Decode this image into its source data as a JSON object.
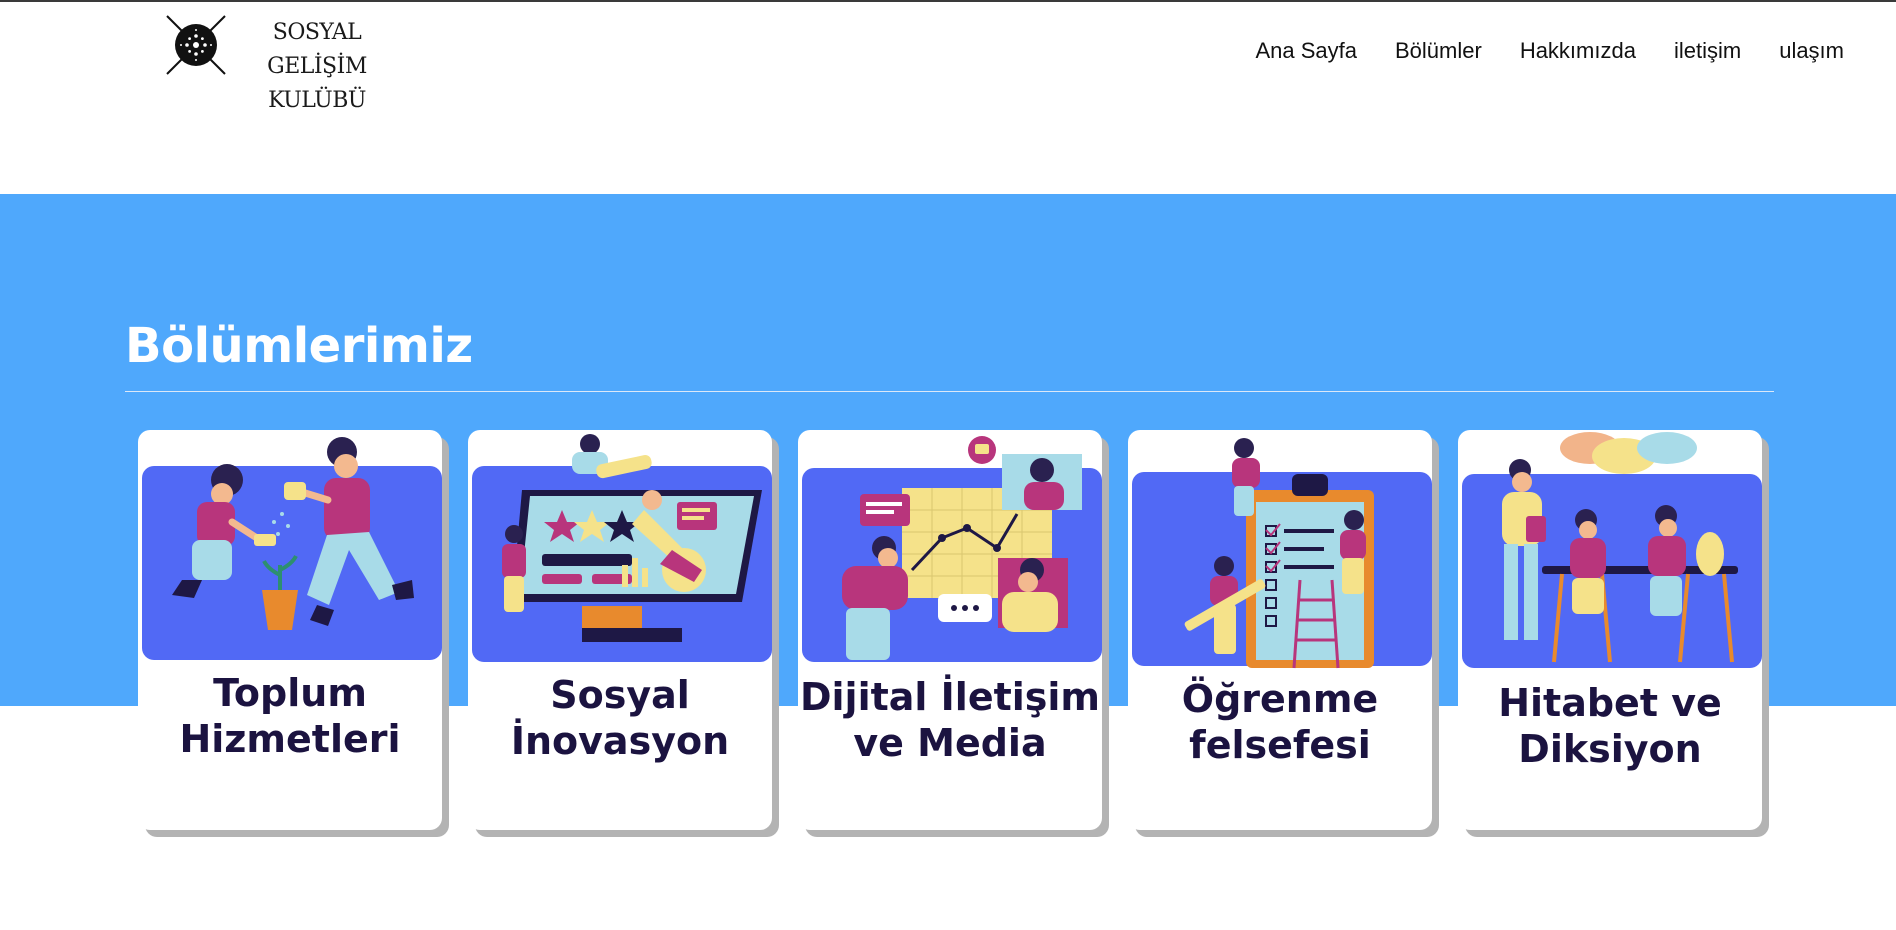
{
  "header": {
    "logo_line1": "SOSYAL GELİŞİM",
    "logo_line2": "KULÜBÜ",
    "logo_icon": "club-emblem-icon",
    "nav": [
      {
        "label": "Ana Sayfa"
      },
      {
        "label": "Bölümler"
      },
      {
        "label": "Hakkımızda"
      },
      {
        "label": "iletişim"
      },
      {
        "label": "ulaşım"
      }
    ]
  },
  "section": {
    "title": "Bölümlerimiz",
    "band_color": "#4fa8fc"
  },
  "cards": [
    {
      "line1": "Toplum",
      "line2": "Hizmetleri",
      "illustration": "community-service-illustration"
    },
    {
      "line1": "Sosyal",
      "line2": "İnovasyon",
      "illustration": "social-innovation-illustration"
    },
    {
      "line1": "Dijital İletişim",
      "line2": "ve Media",
      "illustration": "digital-communication-illustration"
    },
    {
      "line1": "Öğrenme",
      "line2": "felsefesi",
      "illustration": "learning-philosophy-illustration"
    },
    {
      "line1": "Hitabet ve",
      "line2": "Diksiyon",
      "illustration": "rhetoric-diction-illustration"
    }
  ],
  "colors": {
    "card_title": "#1b1340",
    "illustration_bg": "#5169f5",
    "accent_pink": "#b8357c",
    "accent_yellow": "#f5e28a",
    "accent_light_blue": "#a8dbe8"
  }
}
